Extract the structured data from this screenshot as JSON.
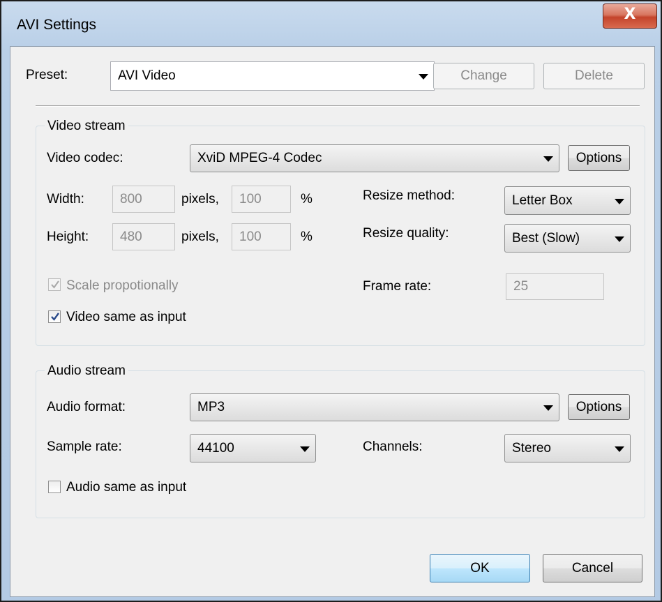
{
  "window": {
    "title": "AVI Settings",
    "close_glyph": "X"
  },
  "preset": {
    "label": "Preset:",
    "value": "AVI Video",
    "change_button": "Change",
    "delete_button": "Delete"
  },
  "video_stream": {
    "group_title": "Video stream",
    "codec_label": "Video codec:",
    "codec_value": "XviD MPEG-4 Codec",
    "options_button": "Options",
    "width_label": "Width:",
    "width_value": "800",
    "width_pixels_unit": "pixels,",
    "width_percent_value": "100",
    "width_percent_unit": "%",
    "height_label": "Height:",
    "height_value": "480",
    "height_pixels_unit": "pixels,",
    "height_percent_value": "100",
    "height_percent_unit": "%",
    "resize_method_label": "Resize method:",
    "resize_method_value": "Letter Box",
    "resize_quality_label": "Resize quality:",
    "resize_quality_value": "Best (Slow)",
    "scale_label": "Scale propotionally",
    "scale_checked": true,
    "frame_rate_label": "Frame rate:",
    "frame_rate_value": "25",
    "same_as_input_label": "Video same as input",
    "same_as_input_checked": true
  },
  "audio_stream": {
    "group_title": "Audio stream",
    "format_label": "Audio format:",
    "format_value": "MP3",
    "options_button": "Options",
    "sample_rate_label": "Sample rate:",
    "sample_rate_value": "44100",
    "channels_label": "Channels:",
    "channels_value": "Stereo",
    "same_as_input_label": "Audio same as input",
    "same_as_input_checked": false
  },
  "footer": {
    "ok_button": "OK",
    "cancel_button": "Cancel"
  },
  "colors": {
    "check_mark": "#2a4a8a",
    "close_button": "#c4442b"
  }
}
